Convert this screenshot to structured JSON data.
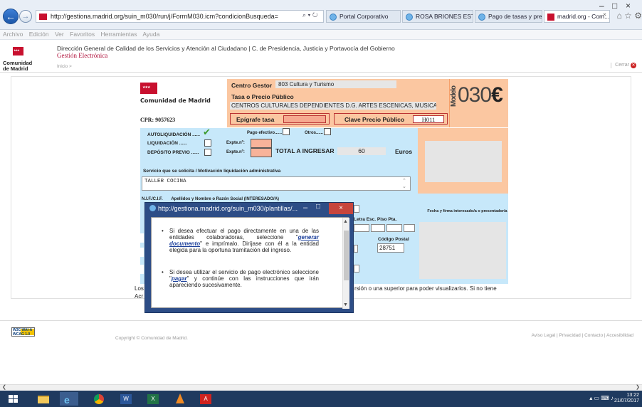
{
  "browser": {
    "url": "http://gestiona.madrid.org/suin_m030/run/j/FormM030.icm?condicionBusqueda=",
    "address_tools": "⌕ ▾ ↻",
    "tabs": [
      {
        "label": "Portal Corporativo"
      },
      {
        "label": "ROSA BRIONES ESTEB..."
      },
      {
        "label": "Pago de tasas y preci..."
      },
      {
        "label": "madrid.org - Com..."
      }
    ],
    "tab_close": "×",
    "window_controls": [
      "–",
      "□",
      "×"
    ],
    "right_icons": "⌂ ☆ ⚙"
  },
  "menu": [
    "Archivo",
    "Edición",
    "Ver",
    "Favoritos",
    "Herramientas",
    "Ayuda"
  ],
  "header": {
    "logo_text": "Comunidad de Madrid",
    "dg_title": "Dirección General de Calidad de los Servicios y Atención al Ciudadano | C. de Presidencia, Justicia y Portavocía del Gobierno",
    "dg_subtitle": "Gestión Electrónica",
    "breadcrumb": "Inicio >",
    "close_label": "Cerrar"
  },
  "form": {
    "logo_text": "Comunidad de Madrid",
    "cpr": "CPR: 9057623",
    "centro_gestor_label": "Centro Gestor",
    "centro_gestor_value": "803 Cultura y Turismo",
    "tasa_label": "Tasa o Precio Público",
    "tasa_value": "CENTROS CULTURALES DEPENDIENTES D.G. ARTES ESCENICAS, MUSICA",
    "epigrafe_label": "Epígrafe tasa",
    "clave_label": "Clave Precio Público",
    "clave_value": "H011",
    "modelo_vertical": "Modelo",
    "modelo_number": "030",
    "modelo_euro": "€",
    "autoliquidacion": "AUTOLIQUIDACIÓN ......",
    "liquidacion": "LIQUIDACIÓN ......",
    "deposito": "DEPÓSITO PREVIO ......",
    "check_mark": "✔",
    "expte1": "Expte.nº:",
    "expte2": "Expte.nº:",
    "pago_efectivo": "Pago efectivo......",
    "otros": "Otros......",
    "total_label": "TOTAL A INGRESAR",
    "total_value": "60",
    "euros": "Euros",
    "servicio_label": "Servicio que se solicita / Motivación liquidación administrativa",
    "servicio_value": "TALLER COCINA",
    "nif_label": "N.I.F./C.I.F.",
    "apellidos_label": "Apellidos y Nombre o Razón Social (INTERESADO/A)",
    "letra_label": "Letra  Esc.  Piso  Pta.",
    "cp_label": "Código Postal",
    "cp_value": "28751",
    "firma_label": "Fecha y firma interesado/a o presentador/a",
    "warning_text": "rsión o una superior para poder visualizarlos. Si no tiene",
    "warning_left": "Los",
    "warning_left2": "Acr"
  },
  "popup": {
    "title": "http://gestiona.madrid.org/suin_m030/plantillas/...",
    "minimize": "–",
    "maximize": "□",
    "close": "×",
    "para1_a": "Si desea efectuar el pago directamente en una de las entidades colaboradoras, seleccione \"",
    "para1_link": "generar documento",
    "para1_b": "\" e imprímalo. Diríjase con él a la entidad elegida para la oportuna tramitación del ingreso.",
    "para2_a": "Si desea utilizar el servicio de pago electrónico seleccione \"",
    "para2_link": "pagar",
    "para2_b": "\" y continúe con las instrucciones que irán apareciendo sucesivamente."
  },
  "footer": {
    "wai_text": "W3C WAI-A WCAG 1.0",
    "copyright": "Copyright © Comunidad de Madrid.",
    "links": "Aviso Legal | Privacidad | Contacto | Accesibilidad"
  },
  "taskbar": {
    "time": "13:22",
    "date": "21/07/2017"
  }
}
